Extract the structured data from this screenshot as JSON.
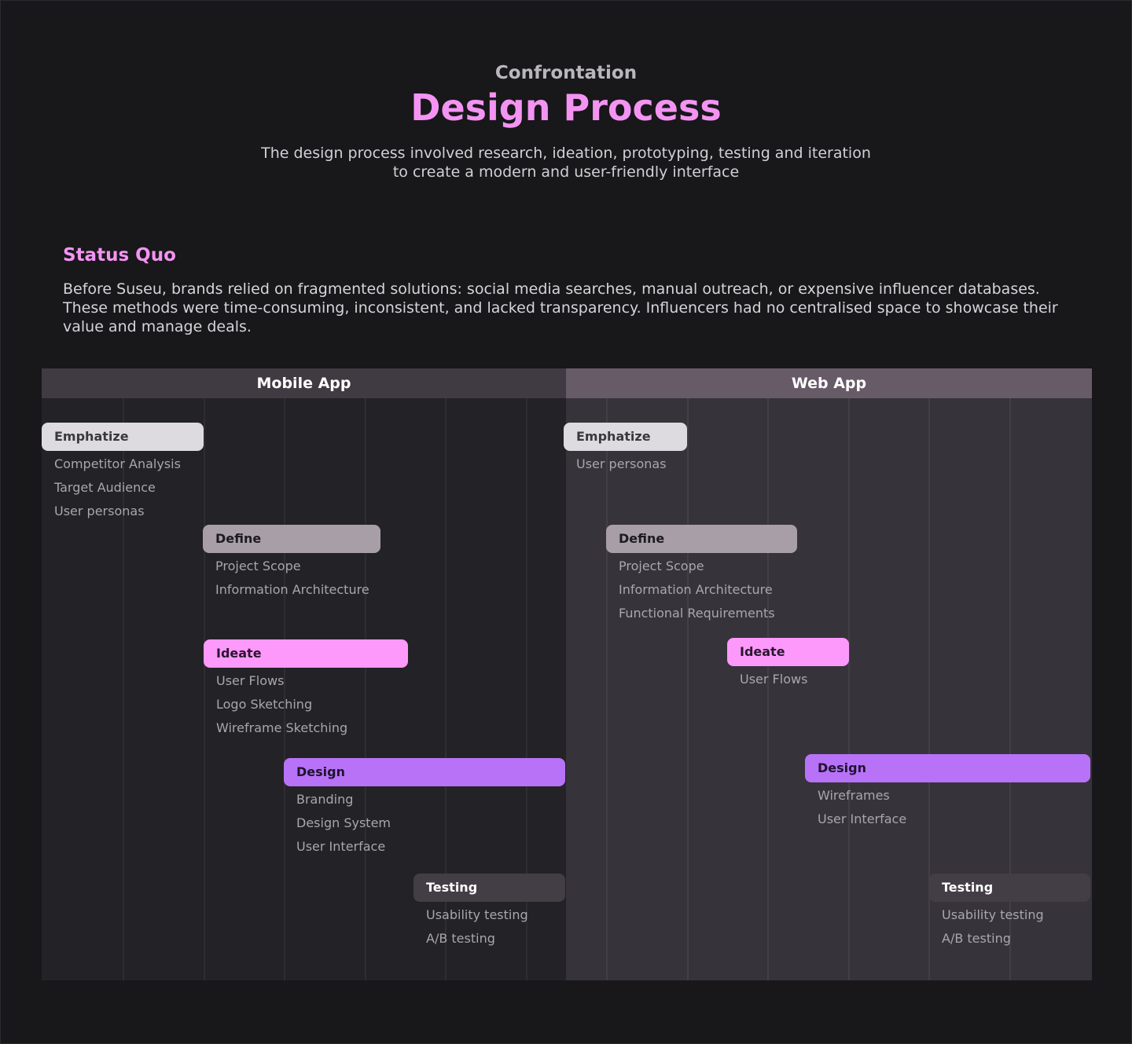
{
  "header": {
    "eyebrow": "Confrontation",
    "title": "Design Process",
    "subtitle_line1": "The design process involved research, ideation, prototyping, testing and iteration",
    "subtitle_line2": "to create a modern and user-friendly interface"
  },
  "status_quo": {
    "title": "Status Quo",
    "text": "Before Suseu, brands relied on fragmented solutions: social media searches, manual outreach, or expensive influencer databases. These methods were time-consuming, inconsistent, and lacked transparency. Influencers had no centralised space to showcase their value and manage deals."
  },
  "colors": {
    "accent": "#f394f2",
    "emphatize": "#dedbe0",
    "define": "#a89ea8",
    "ideate": "#fd99fb",
    "design": "#b872f7",
    "testing": "#433e46"
  },
  "mobile": {
    "title": "Mobile App",
    "phases": [
      {
        "label": "Emphatize",
        "items": [
          "Competitor Analysis",
          "Target Audience",
          "User personas"
        ]
      },
      {
        "label": "Define",
        "items": [
          "Project Scope",
          "Information Architecture"
        ]
      },
      {
        "label": "Ideate",
        "items": [
          "User Flows",
          "Logo Sketching",
          "Wireframe Sketching"
        ]
      },
      {
        "label": "Design",
        "items": [
          "Branding",
          "Design System",
          "User Interface"
        ]
      },
      {
        "label": "Testing",
        "items": [
          "Usability testing",
          "A/B testing"
        ]
      }
    ]
  },
  "web": {
    "title": "Web App",
    "phases": [
      {
        "label": "Emphatize",
        "items": [
          "User personas"
        ]
      },
      {
        "label": "Define",
        "items": [
          "Project Scope",
          "Information Architecture",
          "Functional Requirements"
        ]
      },
      {
        "label": "Ideate",
        "items": [
          "User Flows"
        ]
      },
      {
        "label": "Design",
        "items": [
          "Wireframes",
          "User Interface"
        ]
      },
      {
        "label": "Testing",
        "items": [
          "Usability testing",
          "A/B testing"
        ]
      }
    ]
  }
}
